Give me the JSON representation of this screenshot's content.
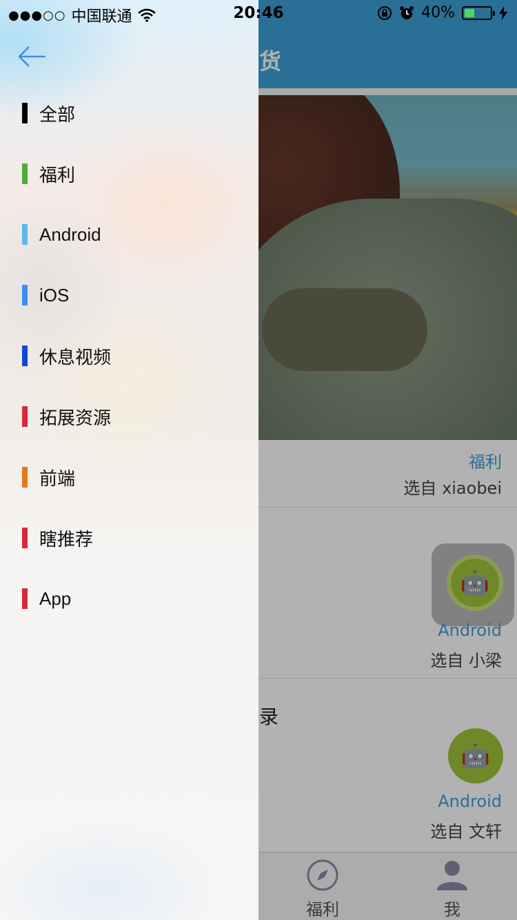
{
  "status_bar": {
    "signal": "●●●○○",
    "carrier": "中国联通",
    "time": "20:46",
    "battery_text": "40%",
    "battery_level": 0.4,
    "icons": [
      "wifi-icon",
      "rotation-lock-icon",
      "alarm-icon",
      "battery-icon",
      "charging-icon"
    ]
  },
  "drawer": {
    "back_icon": "arrow-left-icon",
    "accent": "#3d8ee6",
    "items": [
      {
        "label": "全部",
        "color": "#000000"
      },
      {
        "label": "福利",
        "color": "#4fad3a"
      },
      {
        "label": "Android",
        "color": "#5ab8e8"
      },
      {
        "label": "iOS",
        "color": "#3a8ff0"
      },
      {
        "label": "休息视频",
        "color": "#1246d6"
      },
      {
        "label": "拓展资源",
        "color": "#d8283e"
      },
      {
        "label": "前端",
        "color": "#e27a18"
      },
      {
        "label": "瞎推荐",
        "color": "#d8283e"
      },
      {
        "label": "App",
        "color": "#d8283e"
      }
    ]
  },
  "background": {
    "nav_title_fragment": "货",
    "cards": [
      {
        "tag": "福利",
        "by": "选自 xiaobei"
      },
      {
        "tag": "Android",
        "by": "选自 小梁"
      },
      {
        "fragment": "录",
        "tag": "Android",
        "by": "选自 文轩"
      }
    ],
    "tabs": [
      {
        "label": "福利",
        "icon": "compass-icon"
      },
      {
        "label": "我",
        "icon": "person-icon"
      }
    ]
  }
}
